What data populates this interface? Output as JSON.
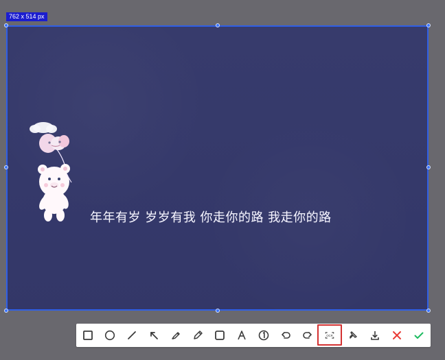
{
  "screen": {
    "background": "#69686e",
    "selection_border_color": "#2f5fe6",
    "selection_background": "#34386a"
  },
  "selection": {
    "size_label": "762 x 514 px"
  },
  "content": {
    "caption": "年年有岁  岁岁有我  你走你的路  我走你的路"
  },
  "toolbar": {
    "tools": [
      {
        "name": "rectangle-tool",
        "icon": "square-outline-icon"
      },
      {
        "name": "ellipse-tool",
        "icon": "circle-outline-icon"
      },
      {
        "name": "line-tool",
        "icon": "line-icon"
      },
      {
        "name": "arrow-tool",
        "icon": "arrow-up-left-icon"
      },
      {
        "name": "marker-tool",
        "icon": "marker-icon"
      },
      {
        "name": "pencil-tool",
        "icon": "pencil-icon"
      },
      {
        "name": "mosaic-tool",
        "icon": "rounded-square-icon"
      },
      {
        "name": "text-tool",
        "icon": "text-icon",
        "label": "A"
      },
      {
        "name": "number-tool",
        "icon": "numbered-circle-icon",
        "label": "1"
      },
      {
        "name": "undo-tool",
        "icon": "undo-icon"
      },
      {
        "name": "redo-tool",
        "icon": "redo-icon"
      },
      {
        "name": "ocr-tool",
        "icon": "ocr-icon",
        "label": "OCR"
      },
      {
        "name": "pin-tool",
        "icon": "pin-icon"
      },
      {
        "name": "download-tool",
        "icon": "download-icon"
      },
      {
        "name": "cancel-tool",
        "icon": "close-icon"
      },
      {
        "name": "confirm-tool",
        "icon": "check-icon"
      }
    ],
    "accent_red": "#ea3b36",
    "accent_green": "#1dbb60",
    "highlight_color": "#d33131"
  }
}
